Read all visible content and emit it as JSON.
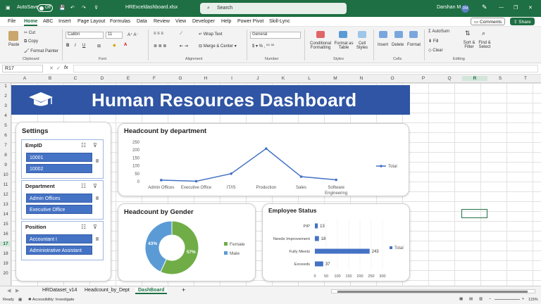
{
  "window": {
    "autosave_label": "AutoSave",
    "autosave_state": "Off",
    "file_name": "HRExceldashboard.xlsx",
    "search_placeholder": "Search",
    "user_name": "Darshan M",
    "user_initials": "DM"
  },
  "menu": {
    "items": [
      "File",
      "Home",
      "ABC",
      "Insert",
      "Page Layout",
      "Formulas",
      "Data",
      "Review",
      "View",
      "Developer",
      "Help",
      "Power Pivot",
      "Skill-Lync"
    ],
    "active": "Home",
    "comments_label": "Comments",
    "share_label": "Share"
  },
  "ribbon": {
    "paste": "Paste",
    "cut": "Cut",
    "copy": "Copy",
    "format_painter": "Format Painter",
    "clipboard": "Clipboard",
    "font_name": "Calibri",
    "font_size": "11",
    "font": "Font",
    "wrap_text": "Wrap Text",
    "merge_center": "Merge & Center",
    "alignment": "Alignment",
    "number_format": "General",
    "number": "Number",
    "conditional_formatting": [
      "Conditional",
      "Formatting"
    ],
    "format_as_table": [
      "Format as",
      "Table"
    ],
    "cell_styles": [
      "Cell",
      "Styles"
    ],
    "styles": "Styles",
    "insert": "Insert",
    "delete": "Delete",
    "format": "Format",
    "cells": "Cells",
    "autosum": "AutoSum",
    "fill": "Fill",
    "clear": "Clear",
    "sort_filter": [
      "Sort &",
      "Filter"
    ],
    "find_select": [
      "Find &",
      "Select"
    ],
    "editing": "Editing"
  },
  "formula_bar": {
    "name_box": "R17",
    "fx": "fx",
    "value": ""
  },
  "columns": [
    "A",
    "B",
    "C",
    "D",
    "E",
    "F",
    "G",
    "H",
    "I",
    "J",
    "K",
    "L",
    "M",
    "N",
    "O",
    "P",
    "Q",
    "R",
    "S",
    "T"
  ],
  "rows": [
    "1",
    "2",
    "3",
    "4",
    "5",
    "6",
    "7",
    "8",
    "9",
    "10",
    "11",
    "12",
    "13",
    "14",
    "15",
    "16",
    "17",
    "18",
    "19",
    "20"
  ],
  "dashboard": {
    "title": "Human Resources Dashboard"
  },
  "settings": {
    "title": "Settings",
    "slicers": [
      {
        "header": "EmpID",
        "items": [
          "10001",
          "10002"
        ]
      },
      {
        "header": "Department",
        "items": [
          "Admin Offices",
          "Executive Office"
        ]
      },
      {
        "header": "Position",
        "items": [
          "Accountant I",
          "Administrative Assistant"
        ]
      }
    ]
  },
  "chart_data": [
    {
      "type": "line",
      "title": "Headcount by department",
      "categories": [
        "Admin Offices",
        "Executive Office",
        "IT/IS",
        "Production",
        "Sales",
        "Software Engineering"
      ],
      "series": [
        {
          "name": "Total",
          "values": [
            9,
            2,
            50,
            209,
            31,
            11
          ]
        }
      ],
      "ylim": [
        0,
        250
      ],
      "yticks": [
        0,
        50,
        100,
        150,
        200,
        250
      ],
      "legend": "right",
      "color": "#4472c4"
    },
    {
      "type": "pie",
      "title": "Headcount by Gender",
      "categories": [
        "Female",
        "Male"
      ],
      "values": [
        57,
        43
      ],
      "labels": [
        "57%",
        "43%"
      ],
      "colors": [
        "#70ad47",
        "#5b9bd5"
      ],
      "legend": "right",
      "donut": true
    },
    {
      "type": "bar",
      "title": "Employee Status",
      "categories": [
        "PIP",
        "Needs Improvement",
        "Fully Meets",
        "Exceeds"
      ],
      "series": [
        {
          "name": "Total",
          "values": [
            13,
            18,
            243,
            37
          ]
        }
      ],
      "xlim": [
        0,
        300
      ],
      "xticks": [
        0,
        50,
        100,
        150,
        200,
        250,
        300
      ],
      "legend": "right",
      "color": "#4472c4"
    }
  ],
  "sheets": {
    "tabs": [
      "HRDataset_v14",
      "Headcount_by_Dept",
      "DashBoard"
    ],
    "active": "DashBoard"
  },
  "status": {
    "ready": "Ready",
    "accessibility": "Accessibility: Investigate",
    "zoom": "115%"
  }
}
